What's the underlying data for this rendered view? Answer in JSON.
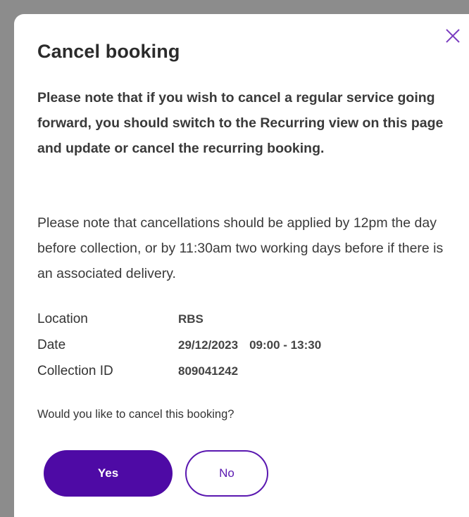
{
  "dialog": {
    "title": "Cancel booking",
    "note_recurring": "Please note that if you wish to cancel a regular service going forward, you should switch to the Recurring view on this page and update or cancel the recurring booking.",
    "note_cutoff": "Please note that cancellations should be applied by 12pm the day before collection, or by 11:30am two working days before if there is an associated delivery.",
    "details": {
      "location_label": "Location",
      "location_value": "RBS",
      "date_label": "Date",
      "date_value": "29/12/2023",
      "time_value": "09:00 - 13:30",
      "collection_label": "Collection ID",
      "collection_value": "809041242"
    },
    "question": "Would you like to cancel this booking?",
    "yes_label": "Yes",
    "no_label": "No",
    "close_icon": "close-icon"
  },
  "colors": {
    "primary": "#4e0aa5",
    "outline": "#5a18b0",
    "overlay": "#8c8c8c"
  }
}
